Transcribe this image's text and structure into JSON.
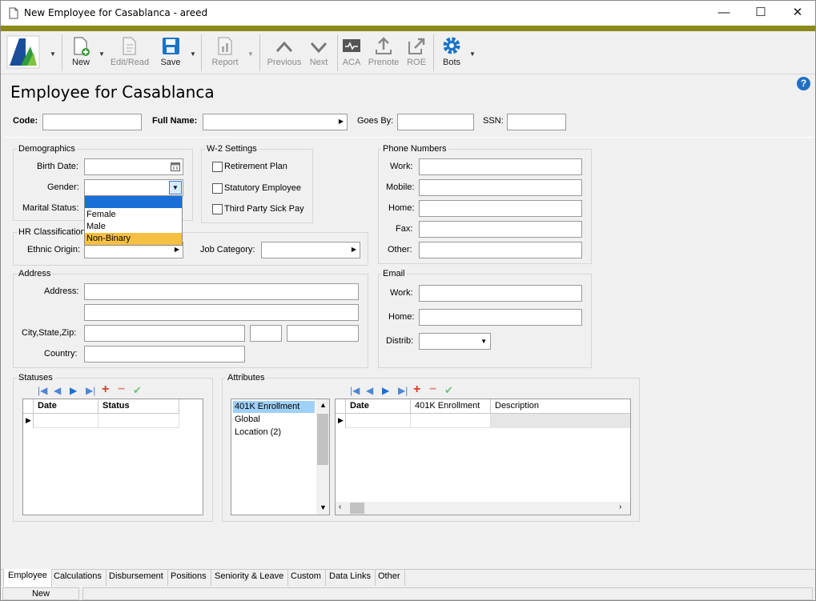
{
  "window": {
    "title": "New Employee for Casablanca - areed",
    "minimize": "—",
    "maximize": "☐",
    "close": "✕"
  },
  "toolbar": {
    "new": "New",
    "edit_read": "Edit/Read",
    "save": "Save",
    "report": "Report",
    "previous": "Previous",
    "next": "Next",
    "aca": "ACA",
    "prenote": "Prenote",
    "roe": "ROE",
    "bots": "Bots"
  },
  "page": {
    "title": "Employee for Casablanca",
    "help": "?"
  },
  "header_fields": {
    "code_label": "Code:",
    "code_value": "",
    "fullname_label": "Full Name:",
    "fullname_value": "",
    "goesby_label": "Goes By:",
    "goesby_value": "",
    "ssn_label": "SSN:",
    "ssn_value": ""
  },
  "demographics": {
    "title": "Demographics",
    "birth_date": "Birth Date:",
    "birth_date_value": "",
    "gender": "Gender:",
    "gender_value": "",
    "marital_status": "Marital Status:",
    "gender_options": [
      "",
      "Female",
      "Male",
      "Non-Binary"
    ],
    "highlighted_option": "Non-Binary"
  },
  "w2": {
    "title": "W-2 Settings",
    "retirement_plan": "Retirement Plan",
    "retirement_checked": false,
    "statutory_employee": "Statutory Employee",
    "statutory_checked": false,
    "third_party_sick_pay": "Third Party Sick Pay",
    "third_party_checked": false
  },
  "phone_numbers": {
    "title": "Phone Numbers",
    "work": "Work:",
    "mobile": "Mobile:",
    "home": "Home:",
    "fax": "Fax:",
    "other": "Other:"
  },
  "hr_classifications": {
    "title": "HR Classifications",
    "ethnic_origin": "Ethnic Origin:",
    "job_category": "Job Category:"
  },
  "address": {
    "title": "Address",
    "address": "Address:",
    "city_state_zip": "City,State,Zip:",
    "country": "Country:"
  },
  "email": {
    "title": "Email",
    "work": "Work:",
    "home": "Home:",
    "distrib": "Distrib:"
  },
  "statuses": {
    "title": "Statuses",
    "columns": [
      "Date",
      "Status"
    ]
  },
  "attributes": {
    "title": "Attributes",
    "list": [
      "401K Enrollment",
      "Global",
      "Location (2)"
    ],
    "selected": "401K Enrollment",
    "columns": [
      "Date",
      "401K Enrollment",
      "Description"
    ]
  },
  "tabs": [
    "Employee",
    "Calculations",
    "Disbursement",
    "Positions",
    "Seniority & Leave",
    "Custom",
    "Data Links",
    "Other"
  ],
  "active_tab": "Employee",
  "status_bar": {
    "mode": "New"
  },
  "colors": {
    "accent_olive": "#8b8a1a",
    "selection_blue": "#1a6fd6",
    "highlight_orange": "#f6c142",
    "save_blue": "#1a74c8",
    "help_blue": "#1f6fc4"
  }
}
